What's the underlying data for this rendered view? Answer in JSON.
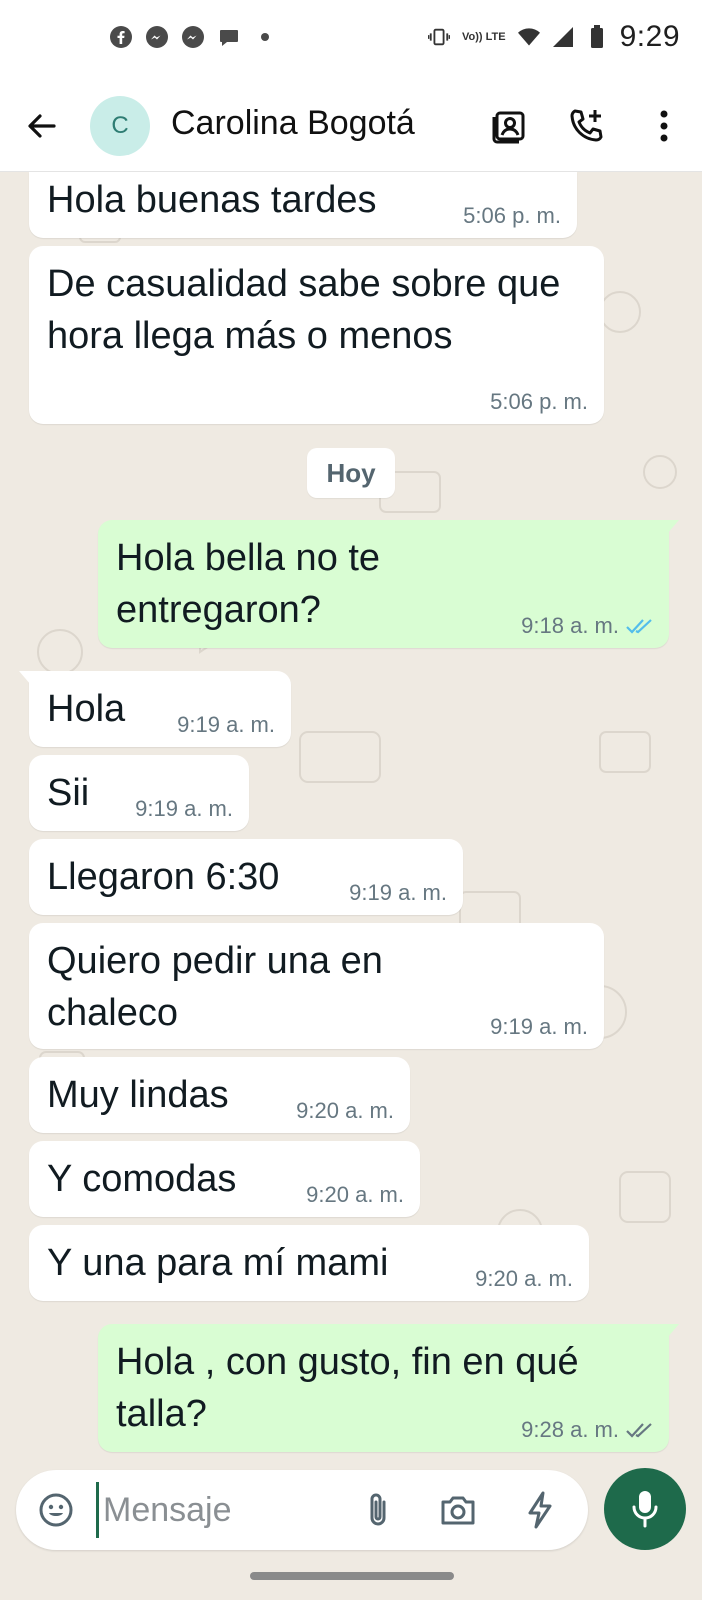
{
  "status_bar": {
    "time": "9:29",
    "volte": "Vo)) LTE",
    "notification_icons": [
      "facebook-icon",
      "messenger-icon",
      "messenger-icon",
      "chat-bubble-icon",
      "dot-icon"
    ],
    "system_icons": [
      "vibrate-icon",
      "volte-icon",
      "wifi-icon",
      "signal-icon",
      "battery-icon"
    ]
  },
  "header": {
    "avatar_initial": "C",
    "contact_name": "Carolina Bogotá",
    "actions": [
      "contact-card-icon",
      "add-call-icon",
      "more-vert-icon"
    ]
  },
  "chat": {
    "date_chip": "Hoy",
    "messages": [
      {
        "direction": "in",
        "text": "Hola buenas tardes",
        "time": "5:06 p. m."
      },
      {
        "direction": "in",
        "text": "De casualidad sabe sobre que hora llega más o menos",
        "time": "5:06 p. m."
      },
      {
        "direction": "out",
        "text": "Hola bella no te entregaron?",
        "time": "9:18 a. m.",
        "status": "read"
      },
      {
        "direction": "in",
        "text": "Hola",
        "time": "9:19 a. m."
      },
      {
        "direction": "in",
        "text": "Sii",
        "time": "9:19 a. m."
      },
      {
        "direction": "in",
        "text": "Llegaron 6:30",
        "time": "9:19 a. m."
      },
      {
        "direction": "in",
        "text": "Quiero pedir una en chaleco",
        "time": "9:19 a. m."
      },
      {
        "direction": "in",
        "text": "Muy lindas",
        "time": "9:20 a. m."
      },
      {
        "direction": "in",
        "text": "Y comodas",
        "time": "9:20 a. m."
      },
      {
        "direction": "in",
        "text": "Y una para mí mami",
        "time": "9:20 a. m."
      },
      {
        "direction": "out",
        "text": "Hola , con gusto, fin en qué talla?",
        "time": "9:28 a. m.",
        "status": "delivered"
      }
    ]
  },
  "composer": {
    "placeholder": "Mensaje",
    "value": "",
    "icons": [
      "emoji-icon",
      "attach-icon",
      "camera-icon",
      "bolt-icon"
    ],
    "mic": "mic-icon"
  },
  "colors": {
    "outgoing_bubble": "#d9fdd3",
    "incoming_bubble": "#ffffff",
    "chat_background": "#efeae2",
    "accent": "#1e6a4b",
    "read_tick": "#53bdeb",
    "delivered_tick": "#667781"
  }
}
